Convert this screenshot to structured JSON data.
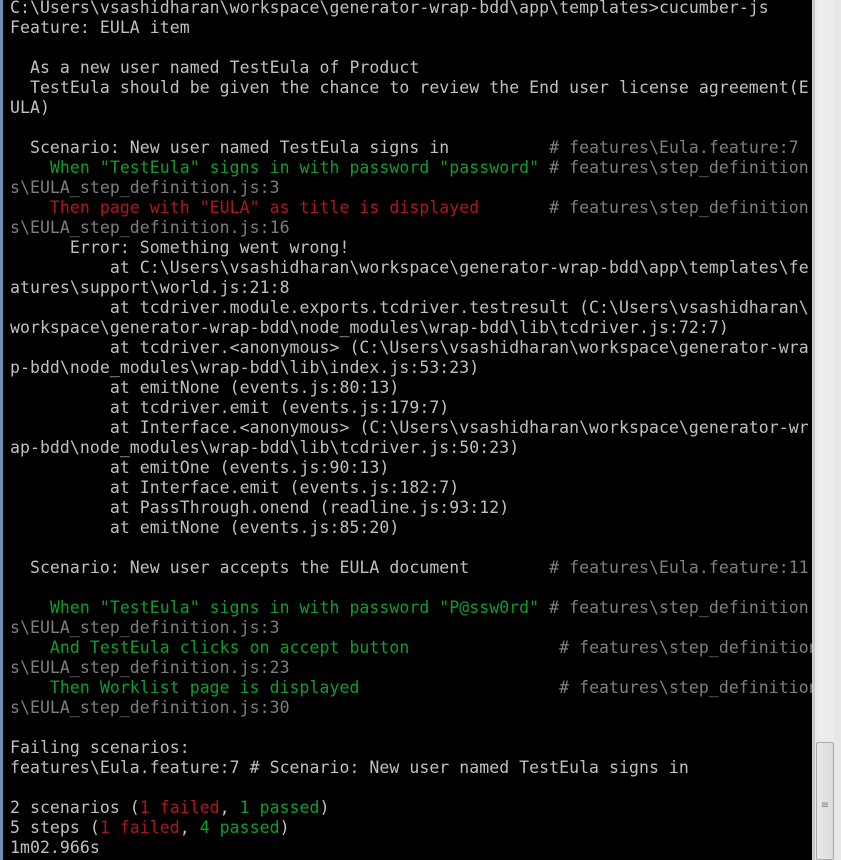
{
  "terminal": {
    "colors": {
      "background": "#000000",
      "default_text": "#c0c0c0",
      "passed": "#0f9d2e",
      "failed": "#b0161d",
      "comment": "#7f7f7f"
    },
    "lines": [
      [
        {
          "t": "C:\\Users\\vsashidharan\\workspace\\generator-wrap-bdd\\app\\templates>cucumber-js",
          "c": "default"
        }
      ],
      [
        {
          "t": "Feature: EULA item",
          "c": "default"
        }
      ],
      [
        {
          "t": "",
          "c": "default"
        }
      ],
      [
        {
          "t": "  As a new user named TestEula of Product",
          "c": "default"
        }
      ],
      [
        {
          "t": "  TestEula should be given the chance to review the End user license agreement(E",
          "c": "default"
        }
      ],
      [
        {
          "t": "ULA)",
          "c": "default"
        }
      ],
      [
        {
          "t": "",
          "c": "default"
        }
      ],
      [
        {
          "t": "  Scenario: New user named TestEula signs in          ",
          "c": "default"
        },
        {
          "t": "# features\\Eula.feature:7",
          "c": "gray"
        }
      ],
      [
        {
          "t": "    When \"TestEula\" signs in with password \"password\" ",
          "c": "green"
        },
        {
          "t": "# features\\step_definition",
          "c": "gray"
        }
      ],
      [
        {
          "t": "s\\EULA_step_definition.js:3",
          "c": "gray"
        }
      ],
      [
        {
          "t": "    Then page with \"EULA\" as title is displayed       ",
          "c": "red"
        },
        {
          "t": "# features\\step_definition",
          "c": "gray"
        }
      ],
      [
        {
          "t": "s\\EULA_step_definition.js:16",
          "c": "gray"
        }
      ],
      [
        {
          "t": "      Error: Something went wrong!",
          "c": "default"
        }
      ],
      [
        {
          "t": "          at C:\\Users\\vsashidharan\\workspace\\generator-wrap-bdd\\app\\templates\\fe",
          "c": "default"
        }
      ],
      [
        {
          "t": "atures\\support\\world.js:21:8",
          "c": "default"
        }
      ],
      [
        {
          "t": "          at tcdriver.module.exports.tcdriver.testresult (C:\\Users\\vsashidharan\\",
          "c": "default"
        }
      ],
      [
        {
          "t": "workspace\\generator-wrap-bdd\\node_modules\\wrap-bdd\\lib\\tcdriver.js:72:7)",
          "c": "default"
        }
      ],
      [
        {
          "t": "          at tcdriver.<anonymous> (C:\\Users\\vsashidharan\\workspace\\generator-wra",
          "c": "default"
        }
      ],
      [
        {
          "t": "p-bdd\\node_modules\\wrap-bdd\\lib\\index.js:53:23)",
          "c": "default"
        }
      ],
      [
        {
          "t": "          at emitNone (events.js:80:13)",
          "c": "default"
        }
      ],
      [
        {
          "t": "          at tcdriver.emit (events.js:179:7)",
          "c": "default"
        }
      ],
      [
        {
          "t": "          at Interface.<anonymous> (C:\\Users\\vsashidharan\\workspace\\generator-wr",
          "c": "default"
        }
      ],
      [
        {
          "t": "ap-bdd\\node_modules\\wrap-bdd\\lib\\tcdriver.js:50:23)",
          "c": "default"
        }
      ],
      [
        {
          "t": "          at emitOne (events.js:90:13)",
          "c": "default"
        }
      ],
      [
        {
          "t": "          at Interface.emit (events.js:182:7)",
          "c": "default"
        }
      ],
      [
        {
          "t": "          at PassThrough.onend (readline.js:93:12)",
          "c": "default"
        }
      ],
      [
        {
          "t": "          at emitNone (events.js:85:20)",
          "c": "default"
        }
      ],
      [
        {
          "t": "",
          "c": "default"
        }
      ],
      [
        {
          "t": "  Scenario: New user accepts the EULA document        ",
          "c": "default"
        },
        {
          "t": "# features\\Eula.feature:11",
          "c": "gray"
        }
      ],
      [
        {
          "t": "",
          "c": "default"
        }
      ],
      [
        {
          "t": "    When \"TestEula\" signs in with password \"P@ssw0rd\" ",
          "c": "green"
        },
        {
          "t": "# features\\step_definition",
          "c": "gray"
        }
      ],
      [
        {
          "t": "s\\EULA_step_definition.js:3",
          "c": "gray"
        }
      ],
      [
        {
          "t": "    And TestEula clicks on accept button               ",
          "c": "green"
        },
        {
          "t": "# features\\step_definition",
          "c": "gray"
        }
      ],
      [
        {
          "t": "s\\EULA_step_definition.js:23",
          "c": "gray"
        }
      ],
      [
        {
          "t": "    Then Worklist page is displayed                    ",
          "c": "green"
        },
        {
          "t": "# features\\step_definition",
          "c": "gray"
        }
      ],
      [
        {
          "t": "s\\EULA_step_definition.js:30",
          "c": "gray"
        }
      ],
      [
        {
          "t": "",
          "c": "default"
        }
      ],
      [
        {
          "t": "Failing scenarios:",
          "c": "default"
        }
      ],
      [
        {
          "t": "features\\Eula.feature:7 # Scenario: New user named TestEula signs in",
          "c": "default"
        }
      ],
      [
        {
          "t": "",
          "c": "default"
        }
      ],
      [
        {
          "t": "2 scenarios (",
          "c": "default"
        },
        {
          "t": "1 failed",
          "c": "red"
        },
        {
          "t": ", ",
          "c": "default"
        },
        {
          "t": "1 passed",
          "c": "green"
        },
        {
          "t": ")",
          "c": "default"
        }
      ],
      [
        {
          "t": "5 steps (",
          "c": "default"
        },
        {
          "t": "1 failed",
          "c": "red"
        },
        {
          "t": ", ",
          "c": "default"
        },
        {
          "t": "4 passed",
          "c": "green"
        },
        {
          "t": ")",
          "c": "default"
        }
      ],
      [
        {
          "t": "1m02.966s",
          "c": "default"
        }
      ]
    ]
  },
  "scrollbar": {
    "grip_glyph": "≡",
    "position_fraction": 0.9
  }
}
